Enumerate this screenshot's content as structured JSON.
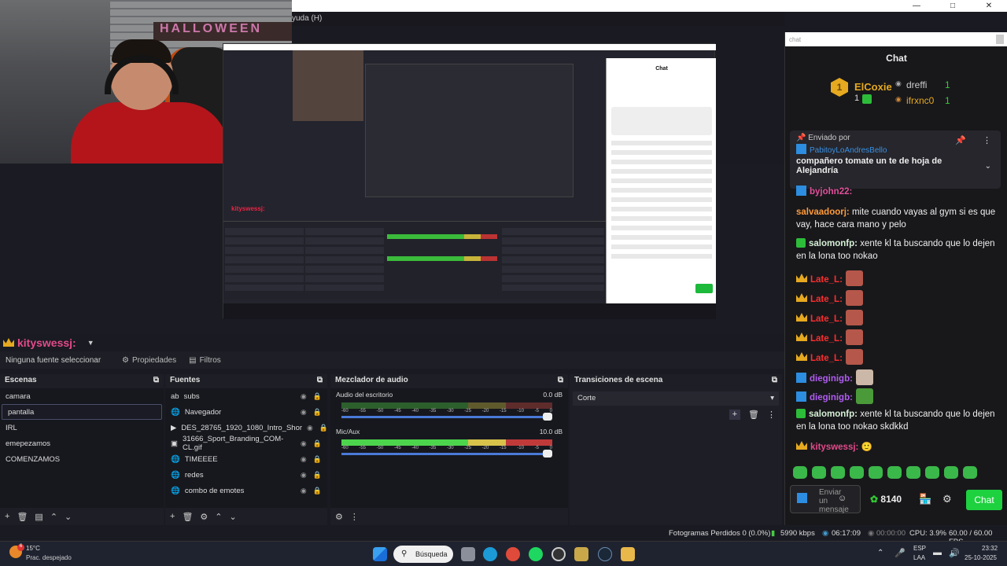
{
  "menu": {
    "help": "yuda (H)"
  },
  "nested_mini": {
    "source_name": "kityswessj:",
    "chat_title": "Chat"
  },
  "preview": {
    "source_name": "kityswessj:"
  },
  "toolbar": {
    "no_source": "Ninguna fuente seleccionar",
    "properties": "Propiedades",
    "filters": "Filtros"
  },
  "scenes": {
    "title": "Escenas",
    "items": [
      "camara",
      "pantalla",
      "IRL",
      "emepezamos",
      "COMENZAMOS"
    ],
    "active": "pantalla"
  },
  "sources": {
    "title": "Fuentes",
    "items": [
      "subs",
      "Navegador",
      "DES_28765_1920_1080_Intro_Shor",
      "31666_Sport_Branding_COM-CL.gif",
      "TIMEEEE",
      "redes",
      "combo de emotes"
    ]
  },
  "mixer": {
    "title": "Mezclador de audio",
    "ch1": {
      "name": "Audio del escritorio",
      "db": "0.0 dB"
    },
    "ch2": {
      "name": "Mic/Aux",
      "db": "10.0 dB"
    },
    "scale": [
      "-60",
      "-55",
      "-50",
      "-45",
      "-40",
      "-35",
      "-30",
      "-25",
      "-20",
      "-15",
      "-10",
      "-5",
      "0"
    ]
  },
  "transitions": {
    "title": "Transiciones de escena",
    "selected": "Corte"
  },
  "status": {
    "dropped": "Fotogramas Perdidos 0 (0.0%)",
    "kbps": "5990 kbps",
    "live": "06:17:09",
    "rec": "00:00:00",
    "cpu": "CPU: 3.9%",
    "fps": "60.00 / 60.00 FPS"
  },
  "chat": {
    "address": "chat",
    "title": "Chat",
    "leader": {
      "first": "ElCoxie",
      "first_count": "1",
      "second": "dreffi",
      "second_count": "1",
      "third": "ifrxnc0",
      "third_count": "1"
    },
    "pinned": {
      "label": "Enviado por",
      "user": "PabitoyLoAndresBello",
      "text": "compañero tomate un te de hoja de Alejandría"
    },
    "partial_user": "byjohn22:",
    "messages": [
      {
        "user": "salvaadoorj:",
        "text": "mite cuando vayas al gym si es que vay, hace cara mano y pelo"
      },
      {
        "user": "salomonfp:",
        "text": "xente kl ta buscando que lo dejen en la lona too nokao"
      },
      {
        "user": "Late_L:",
        "text": ""
      },
      {
        "user": "Late_L:",
        "text": ""
      },
      {
        "user": "Late_L:",
        "text": ""
      },
      {
        "user": "Late_L:",
        "text": ""
      },
      {
        "user": "Late_L:",
        "text": ""
      },
      {
        "user": "dieginigb:",
        "text": ""
      },
      {
        "user": "dieginigb:",
        "text": ""
      },
      {
        "user": "salomonfp:",
        "text": "xente kl ta buscando que lo dejen en la lona too nokao skdkkd"
      },
      {
        "user": "kityswessj:",
        "text": "🙂"
      }
    ],
    "input_placeholder": "Enviar un mensaje",
    "points": "8140",
    "send": "Chat"
  },
  "taskbar": {
    "temp": "15°C",
    "weather": "Prac. despejado",
    "weather_badge": "6",
    "search": "Búsqueda",
    "lang1": "ESP",
    "lang2": "LAA",
    "time": "23:32",
    "date": "25-10-2025"
  },
  "colors": {
    "accent": "#1ed13f",
    "scene_red": "#e34a8a",
    "crown": "#e6a91f"
  }
}
